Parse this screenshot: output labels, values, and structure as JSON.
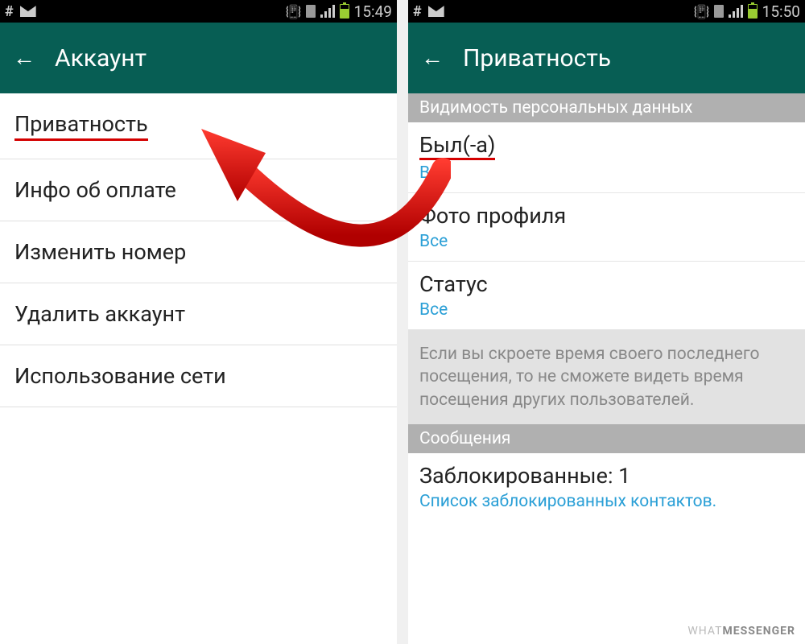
{
  "left": {
    "status": {
      "time": "15:49"
    },
    "appbar": {
      "title": "Аккаунт"
    },
    "items": [
      {
        "label": "Приватность",
        "highlighted": true
      },
      {
        "label": "Инфо об оплате"
      },
      {
        "label": "Изменить номер"
      },
      {
        "label": "Удалить аккаунт"
      },
      {
        "label": "Использование сети"
      }
    ]
  },
  "right": {
    "status": {
      "time": "15:50"
    },
    "appbar": {
      "title": "Приватность"
    },
    "section1_header": "Видимость персональных данных",
    "items": [
      {
        "title": "Был(-а)",
        "sub": "Все",
        "highlighted": true
      },
      {
        "title": "Фото профиля",
        "sub": "Все"
      },
      {
        "title": "Статус",
        "sub": "Все"
      }
    ],
    "info_text": "Если вы скроете время своего последнего посещения, то не сможете видеть время посещения других пользователей.",
    "section2_header": "Сообщения",
    "blocked": {
      "title": "Заблокированные: 1",
      "sub": "Список заблокированных контактов."
    }
  },
  "watermark": {
    "part1": "WHAT",
    "part2": "MESSENGER"
  }
}
